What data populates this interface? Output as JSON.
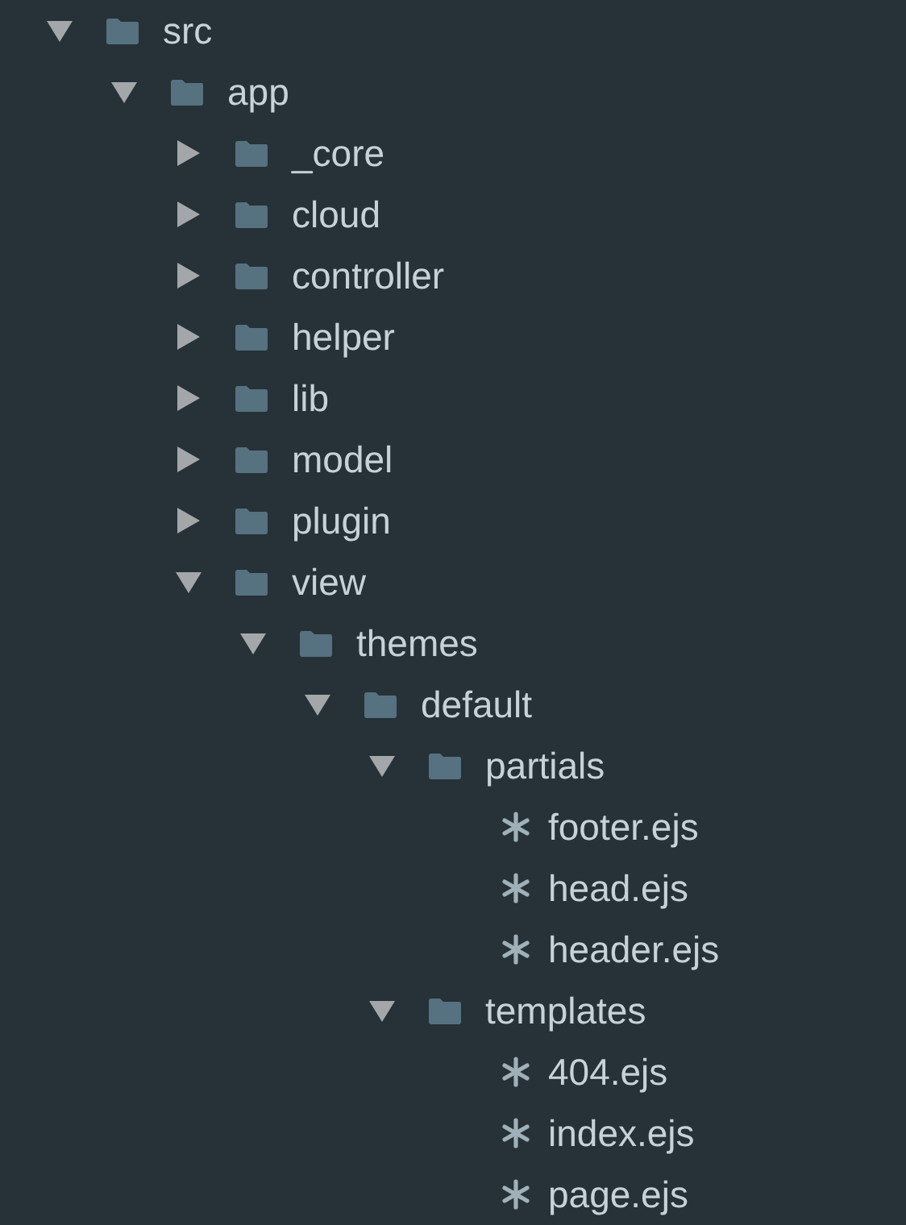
{
  "tree": [
    {
      "name": "src",
      "kind": "folder",
      "expanded": true,
      "children": [
        {
          "name": "app",
          "kind": "folder",
          "expanded": true,
          "children": [
            {
              "name": "_core",
              "kind": "folder",
              "expanded": false
            },
            {
              "name": "cloud",
              "kind": "folder",
              "expanded": false
            },
            {
              "name": "controller",
              "kind": "folder",
              "expanded": false
            },
            {
              "name": "helper",
              "kind": "folder",
              "expanded": false
            },
            {
              "name": "lib",
              "kind": "folder",
              "expanded": false
            },
            {
              "name": "model",
              "kind": "folder",
              "expanded": false
            },
            {
              "name": "plugin",
              "kind": "folder",
              "expanded": false
            },
            {
              "name": "view",
              "kind": "folder",
              "expanded": true,
              "children": [
                {
                  "name": "themes",
                  "kind": "folder",
                  "expanded": true,
                  "children": [
                    {
                      "name": "default",
                      "kind": "folder",
                      "expanded": true,
                      "children": [
                        {
                          "name": "partials",
                          "kind": "folder",
                          "expanded": true,
                          "children": [
                            {
                              "name": "footer.ejs",
                              "kind": "file"
                            },
                            {
                              "name": "head.ejs",
                              "kind": "file"
                            },
                            {
                              "name": "header.ejs",
                              "kind": "file"
                            }
                          ]
                        },
                        {
                          "name": "templates",
                          "kind": "folder",
                          "expanded": true,
                          "children": [
                            {
                              "name": "404.ejs",
                              "kind": "file"
                            },
                            {
                              "name": "index.ejs",
                              "kind": "file"
                            },
                            {
                              "name": "page.ejs",
                              "kind": "file"
                            }
                          ]
                        }
                      ]
                    }
                  ]
                }
              ]
            }
          ]
        }
      ]
    }
  ]
}
